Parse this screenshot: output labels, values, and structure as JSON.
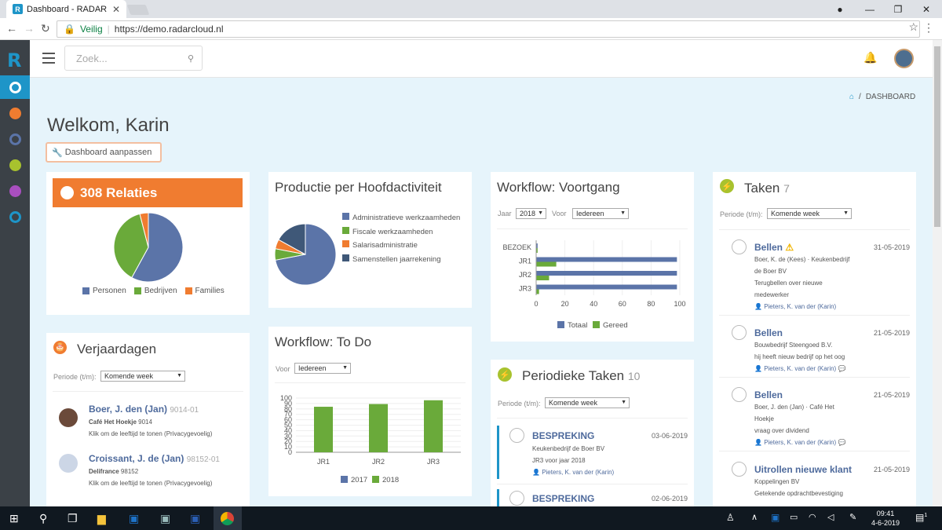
{
  "browser": {
    "tab_title": "Dashboard - RADAR",
    "tab_logo": "R",
    "secure_label": "Veilig",
    "url": "https://demo.radarcloud.nl"
  },
  "app": {
    "search_placeholder": "Zoek...",
    "breadcrumb": "DASHBOARD",
    "welcome": "Welkom, Karin",
    "customize_label": "Dashboard aanpassen"
  },
  "relaties": {
    "title": "308 Relaties",
    "legend": [
      "Personen",
      "Bedrijven",
      "Families"
    ],
    "colors": [
      "#5b74a8",
      "#6aaa3a",
      "#f07c30"
    ],
    "values": [
      58,
      38,
      4
    ]
  },
  "productie": {
    "title": "Productie per Hoofdactiviteit",
    "legend": [
      "Administratieve werkzaamheden",
      "Fiscale werkzaamheden",
      "Salarisadministratie",
      "Samenstellen jaarrekening"
    ],
    "colors": [
      "#5b74a8",
      "#6aaa3a",
      "#f07c30",
      "#3f5878"
    ],
    "values": [
      72,
      6,
      5,
      17
    ]
  },
  "voortgang": {
    "title": "Workflow: Voortgang",
    "filter_jaar_label": "Jaar",
    "filter_jaar_value": "2018",
    "filter_voor_label": "Voor",
    "filter_voor_value": "Iedereen"
  },
  "taken": {
    "title": "Taken",
    "count": "7",
    "periode_label": "Periode (t/m):",
    "periode_value": "Komende week",
    "items": [
      {
        "title": "Bellen",
        "date": "31-05-2019",
        "line1": "Boer, K. de (Kees) · Keukenbedrijf",
        "line2": "de Boer BV",
        "line3": "Terugbellen over nieuwe",
        "line4": "medewerker",
        "user": "Pieters, K. van der (Karin)"
      },
      {
        "title": "Bellen",
        "date": "21-05-2019",
        "line1": "Bouwbedrijf Steengoed B.V.",
        "line2": "hij heeft nieuw bedrijf op het oog",
        "user": "Pieters, K. van der (Karin)"
      },
      {
        "title": "Bellen",
        "date": "21-05-2019",
        "line1": "Boer, J. den (Jan) · Café Het",
        "line2": "Hoekje",
        "line3": "vraag over dividend",
        "user": "Pieters, K. van der (Karin)"
      },
      {
        "title": "Uitrollen nieuwe klant",
        "date": "21-05-2019",
        "line1": "Koppelingen BV",
        "line2": "Getekende opdrachtbevestiging"
      }
    ]
  },
  "verjaardagen": {
    "title": "Verjaardagen",
    "periode_label": "Periode (t/m):",
    "periode_value": "Komende week",
    "items": [
      {
        "name": "Boer, J. den (Jan)",
        "code": "9014-01",
        "company": "Café Het Hoekje",
        "company_code": "9014",
        "note": "Klik om de leeftijd te tonen (Privacygevoelig)"
      },
      {
        "name": "Croissant, J. de (Jan)",
        "code": "98152-01",
        "company": "Delifrance",
        "company_code": "98152",
        "note": "Klik om de leeftijd te tonen (Privacygevoelig)"
      }
    ]
  },
  "todo": {
    "title": "Workflow: To Do",
    "filter_voor_label": "Voor",
    "filter_voor_value": "Iedereen"
  },
  "periodieke": {
    "title": "Periodieke Taken",
    "count": "10",
    "periode_label": "Periode (t/m):",
    "periode_value": "Komende week",
    "items": [
      {
        "title": "BESPREKING",
        "date": "03-06-2019",
        "line1": "Keukenbedrijf de Boer BV",
        "line2": "JR3 voor jaar 2018",
        "user": "Pieters, K. van der (Karin)"
      },
      {
        "title": "BESPREKING",
        "date": "02-06-2019"
      }
    ]
  },
  "taskbar": {
    "time": "09:41",
    "date": "4-6-2019",
    "notifications": "1"
  },
  "chart_data": [
    {
      "type": "bar",
      "orientation": "horizontal",
      "title": "Workflow: Voortgang",
      "categories": [
        "BEZOEK",
        "JR1",
        "JR2",
        "JR3"
      ],
      "series": [
        {
          "name": "Totaal",
          "values": [
            1,
            98,
            98,
            98
          ],
          "color": "#5b74a8"
        },
        {
          "name": "Gereed",
          "values": [
            1,
            14,
            9,
            2
          ],
          "color": "#6aaa3a"
        }
      ],
      "xlim": [
        0,
        100
      ],
      "xticks": [
        0,
        20,
        40,
        60,
        80,
        100
      ],
      "legend": "bottom"
    },
    {
      "type": "bar",
      "title": "Workflow: To Do",
      "categories": [
        "JR1",
        "JR2",
        "JR3"
      ],
      "series": [
        {
          "name": "2017",
          "values": [
            0,
            0,
            0
          ],
          "color": "#5b74a8"
        },
        {
          "name": "2018",
          "values": [
            84,
            89,
            96
          ],
          "color": "#6aaa3a"
        }
      ],
      "ylim": [
        0,
        100
      ],
      "yticks": [
        0,
        10,
        20,
        30,
        40,
        50,
        60,
        70,
        80,
        90,
        100
      ],
      "legend": "bottom"
    }
  ]
}
